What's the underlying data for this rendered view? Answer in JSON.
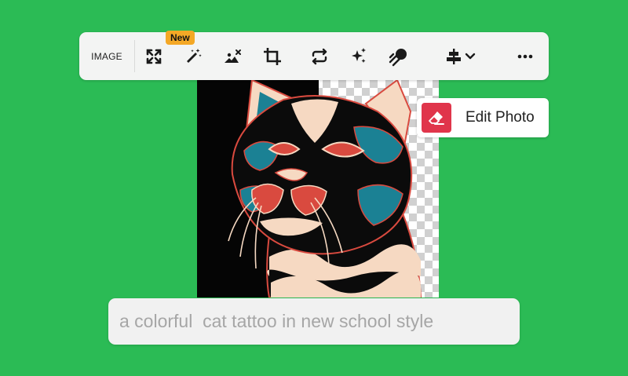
{
  "toolbar": {
    "label": "IMAGE",
    "new_badge": "New",
    "tools": [
      {
        "icon": "expand-icon"
      },
      {
        "icon": "magic-wand-icon"
      },
      {
        "icon": "remove-background-icon"
      },
      {
        "icon": "crop-icon"
      },
      {
        "icon": "swap-icon"
      },
      {
        "icon": "sparkles-icon"
      },
      {
        "icon": "upscale-icon"
      },
      {
        "icon": "align-icon"
      },
      {
        "icon": "more-icon"
      }
    ]
  },
  "edit_photo": {
    "label": "Edit Photo",
    "icon": "eraser-icon",
    "accent": "#e0354b"
  },
  "prompt": {
    "text": "a colorful  cat tattoo in new school style"
  },
  "colors": {
    "background": "#2bbb55",
    "badge": "#f4a826"
  }
}
